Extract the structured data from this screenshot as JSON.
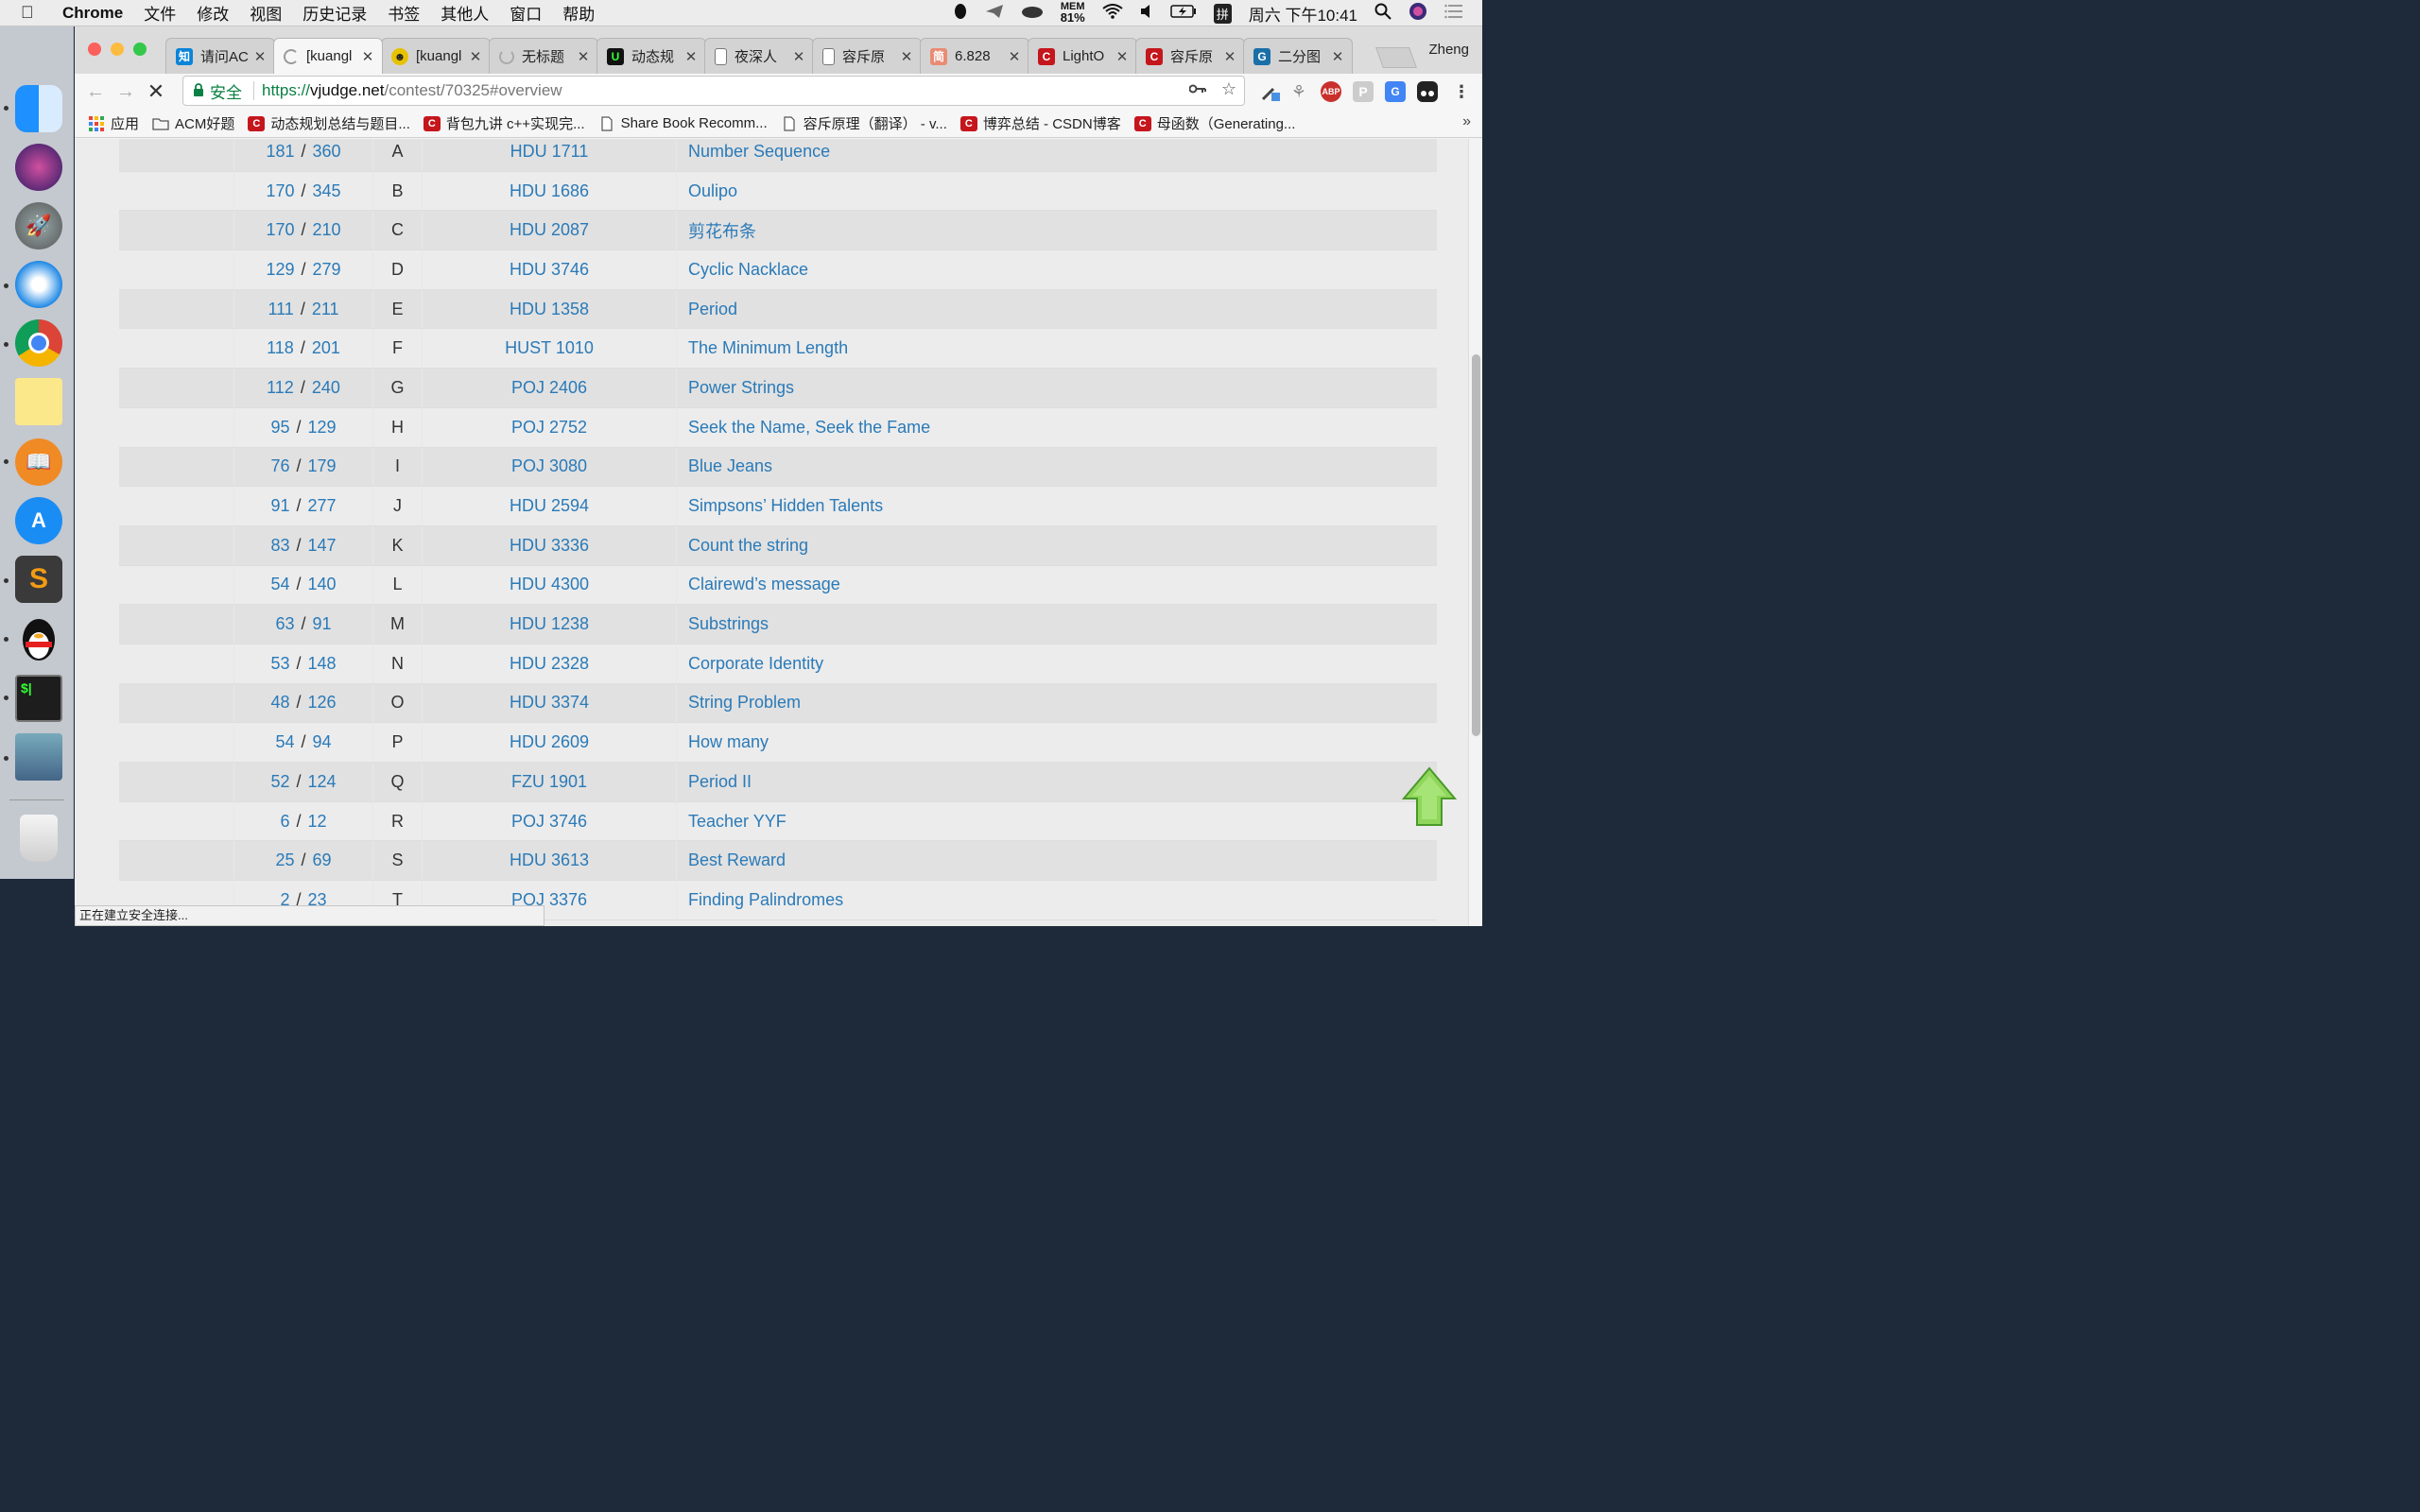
{
  "menubar": {
    "app": "Chrome",
    "items": [
      "文件",
      "修改",
      "视图",
      "历史记录",
      "书签",
      "其他人",
      "窗口",
      "帮助"
    ],
    "mem_label": "MEM",
    "mem_value": "81%",
    "input_method": "拼",
    "clock": "周六 下午10:41"
  },
  "tabs": [
    {
      "label": "请问AC",
      "favicon": "知",
      "color": "#0a84d8"
    },
    {
      "label": "[kuangl",
      "favicon": "loading",
      "color": "#999"
    },
    {
      "label": "[kuangl",
      "favicon": "☻",
      "color": "#e6c200"
    },
    {
      "label": "无标题",
      "favicon": "loading",
      "color": "#999"
    },
    {
      "label": "动态规",
      "favicon": "U",
      "color": "#111"
    },
    {
      "label": "夜深人",
      "favicon": "doc",
      "color": "#888"
    },
    {
      "label": "容斥原",
      "favicon": "doc",
      "color": "#888"
    },
    {
      "label": "6.828",
      "favicon": "简",
      "color": "#e98b74"
    },
    {
      "label": "LightO",
      "favicon": "C",
      "color": "#c4161c"
    },
    {
      "label": "容斥原",
      "favicon": "C",
      "color": "#c4161c"
    },
    {
      "label": "二分图",
      "favicon": "G",
      "color": "#1a6fa8"
    }
  ],
  "profile": "Zheng",
  "omnibox": {
    "secure_label": "安全",
    "url_scheme": "https://",
    "url_host": "vjudge.net",
    "url_path": "/contest/70325#overview"
  },
  "bookmarks": [
    {
      "label": "应用",
      "icon": "apps"
    },
    {
      "label": "ACM好题",
      "icon": "folder"
    },
    {
      "label": "动态规划总结与题目...",
      "icon": "csdn"
    },
    {
      "label": "背包九讲 c++实现完...",
      "icon": "csdn"
    },
    {
      "label": "Share Book Recomm...",
      "icon": "doc"
    },
    {
      "label": "容斥原理（翻译） - v...",
      "icon": "doc"
    },
    {
      "label": "博弈总结 - CSDN博客",
      "icon": "csdn"
    },
    {
      "label": "母函数（Generating...",
      "icon": "csdn"
    }
  ],
  "problems": [
    {
      "solved": "181",
      "attempted": "360",
      "letter": "A",
      "source": "HDU 1711",
      "title": "Number Sequence"
    },
    {
      "solved": "170",
      "attempted": "345",
      "letter": "B",
      "source": "HDU 1686",
      "title": "Oulipo"
    },
    {
      "solved": "170",
      "attempted": "210",
      "letter": "C",
      "source": "HDU 2087",
      "title": "剪花布条"
    },
    {
      "solved": "129",
      "attempted": "279",
      "letter": "D",
      "source": "HDU 3746",
      "title": "Cyclic Nacklace"
    },
    {
      "solved": "111",
      "attempted": "211",
      "letter": "E",
      "source": "HDU 1358",
      "title": "Period"
    },
    {
      "solved": "118",
      "attempted": "201",
      "letter": "F",
      "source": "HUST 1010",
      "title": "The Minimum Length"
    },
    {
      "solved": "112",
      "attempted": "240",
      "letter": "G",
      "source": "POJ 2406",
      "title": "Power Strings"
    },
    {
      "solved": "95",
      "attempted": "129",
      "letter": "H",
      "source": "POJ 2752",
      "title": "Seek the Name, Seek the Fame"
    },
    {
      "solved": "76",
      "attempted": "179",
      "letter": "I",
      "source": "POJ 3080",
      "title": "Blue Jeans"
    },
    {
      "solved": "91",
      "attempted": "277",
      "letter": "J",
      "source": "HDU 2594",
      "title": "Simpsons’ Hidden Talents"
    },
    {
      "solved": "83",
      "attempted": "147",
      "letter": "K",
      "source": "HDU 3336",
      "title": "Count the string"
    },
    {
      "solved": "54",
      "attempted": "140",
      "letter": "L",
      "source": "HDU 4300",
      "title": "Clairewd’s message"
    },
    {
      "solved": "63",
      "attempted": "91",
      "letter": "M",
      "source": "HDU 1238",
      "title": "Substrings"
    },
    {
      "solved": "53",
      "attempted": "148",
      "letter": "N",
      "source": "HDU 2328",
      "title": "Corporate Identity"
    },
    {
      "solved": "48",
      "attempted": "126",
      "letter": "O",
      "source": "HDU 3374",
      "title": "String Problem"
    },
    {
      "solved": "54",
      "attempted": "94",
      "letter": "P",
      "source": "HDU 2609",
      "title": "How many"
    },
    {
      "solved": "52",
      "attempted": "124",
      "letter": "Q",
      "source": "FZU 1901",
      "title": "Period II"
    },
    {
      "solved": "6",
      "attempted": "12",
      "letter": "R",
      "source": "POJ 3746",
      "title": "Teacher YYF"
    },
    {
      "solved": "25",
      "attempted": "69",
      "letter": "S",
      "source": "HDU 3613",
      "title": "Best Reward"
    },
    {
      "solved": "2",
      "attempted": "23",
      "letter": "T",
      "source": "POJ 3376",
      "title": "Finding Palindromes"
    }
  ],
  "status_text": "正在建立安全连接..."
}
